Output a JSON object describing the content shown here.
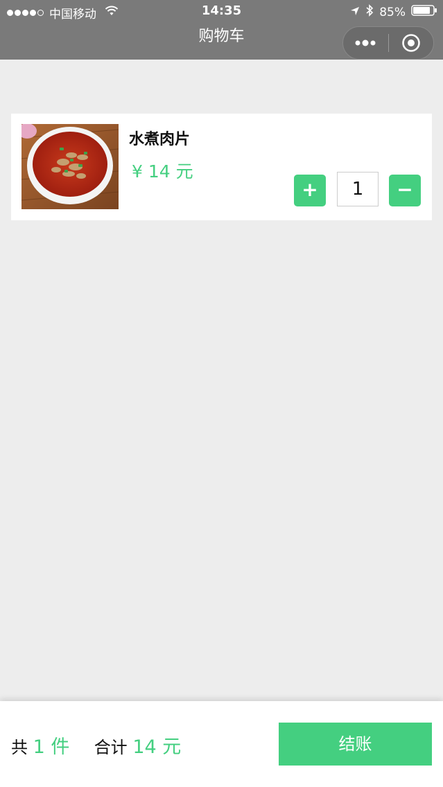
{
  "status_bar": {
    "carrier": "中国移动",
    "time": "14:35",
    "battery": "85%"
  },
  "nav": {
    "title": "购物车"
  },
  "cart": {
    "items": [
      {
        "name": "水煮肉片",
        "price": "¥ 14 元",
        "quantity": "1",
        "plus_label": "+",
        "minus_label": "−"
      }
    ]
  },
  "footer": {
    "count_prefix": "共",
    "count": "1 件",
    "total_prefix": "合计",
    "total": "14 元",
    "checkout_label": "结账"
  },
  "colors": {
    "accent": "#44cf80",
    "nav_bg": "#7a7a7a",
    "page_bg": "#ededed"
  },
  "icons": [
    "signal-icon",
    "wifi-icon",
    "location-icon",
    "bluetooth-icon",
    "battery-icon",
    "more-icon",
    "close-circle-icon"
  ]
}
